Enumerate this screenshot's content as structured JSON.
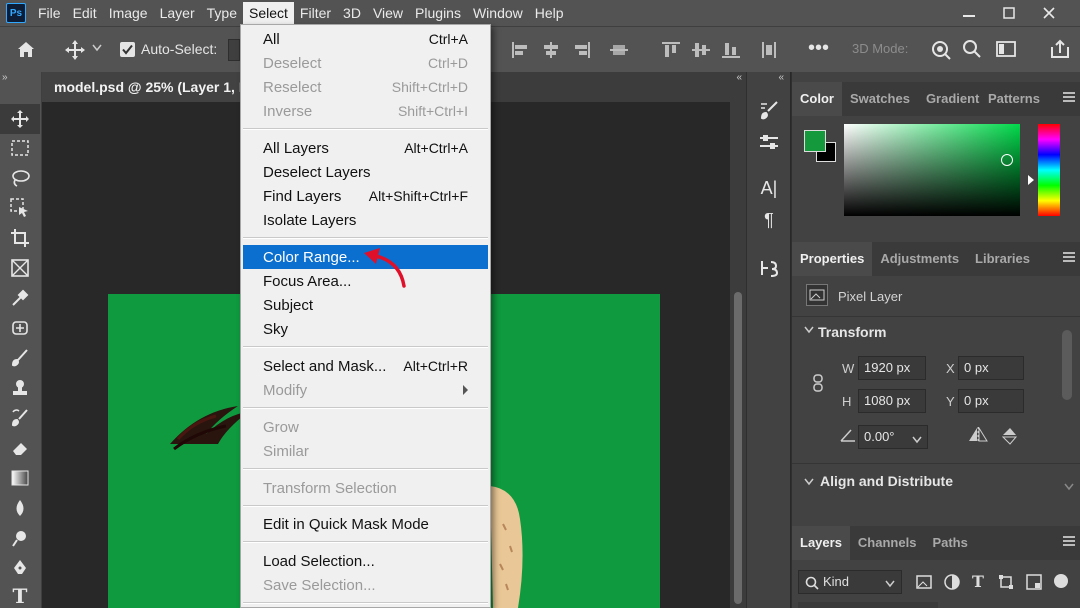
{
  "menubar": {
    "logo": "Ps",
    "items": [
      "File",
      "Edit",
      "Image",
      "Layer",
      "Type",
      "Select",
      "Filter",
      "3D",
      "View",
      "Plugins",
      "Window",
      "Help"
    ],
    "open_menu": "Select",
    "window_controls": [
      "minimize-icon",
      "maximize-icon",
      "close-icon"
    ]
  },
  "options_bar": {
    "auto_select_label": "Auto-Select:",
    "auto_select_checked": true,
    "mode_3d_label": "3D Mode:"
  },
  "document": {
    "tab_title": "model.psd @ 25% (Layer 1, R",
    "canvas_color": "#0f9a3f"
  },
  "select_menu": {
    "items": [
      {
        "label": "All",
        "shortcut": "Ctrl+A",
        "disabled": false
      },
      {
        "label": "Deselect",
        "shortcut": "Ctrl+D",
        "disabled": true
      },
      {
        "label": "Reselect",
        "shortcut": "Shift+Ctrl+D",
        "disabled": true
      },
      {
        "label": "Inverse",
        "shortcut": "Shift+Ctrl+I",
        "disabled": true
      },
      {
        "label": "All Layers",
        "shortcut": "Alt+Ctrl+A",
        "disabled": false
      },
      {
        "label": "Deselect Layers",
        "shortcut": "",
        "disabled": false
      },
      {
        "label": "Find Layers",
        "shortcut": "Alt+Shift+Ctrl+F",
        "disabled": false
      },
      {
        "label": "Isolate Layers",
        "shortcut": "",
        "disabled": false
      },
      {
        "label": "Color Range...",
        "shortcut": "",
        "disabled": false,
        "highlighted": true
      },
      {
        "label": "Focus Area...",
        "shortcut": "",
        "disabled": false
      },
      {
        "label": "Subject",
        "shortcut": "",
        "disabled": false
      },
      {
        "label": "Sky",
        "shortcut": "",
        "disabled": false
      },
      {
        "label": "Select and Mask...",
        "shortcut": "Alt+Ctrl+R",
        "disabled": false
      },
      {
        "label": "Modify",
        "shortcut": "",
        "disabled": true,
        "submenu": true
      },
      {
        "label": "Grow",
        "shortcut": "",
        "disabled": true
      },
      {
        "label": "Similar",
        "shortcut": "",
        "disabled": true
      },
      {
        "label": "Transform Selection",
        "shortcut": "",
        "disabled": true
      },
      {
        "label": "Edit in Quick Mask Mode",
        "shortcut": "",
        "disabled": false
      },
      {
        "label": "Load Selection...",
        "shortcut": "",
        "disabled": false
      },
      {
        "label": "Save Selection...",
        "shortcut": "",
        "disabled": true
      }
    ],
    "highlight_color": "#0b6fd0",
    "annotation_arrow_color": "#e0102a"
  },
  "color_panel": {
    "tabs": [
      "Color",
      "Swatches",
      "Gradients",
      "Patterns"
    ],
    "active_tab": "Color",
    "foreground_color": "#149a3c",
    "background_color": "#000000",
    "picker_hue": "#00d94a"
  },
  "properties_panel": {
    "tabs": [
      "Properties",
      "Adjustments",
      "Libraries"
    ],
    "active_tab": "Properties",
    "layer_type": "Pixel Layer",
    "transform_title": "Transform",
    "w_label": "W",
    "w_value": "1920 px",
    "h_label": "H",
    "h_value": "1080 px",
    "x_label": "X",
    "x_value": "0 px",
    "y_label": "Y",
    "y_value": "0 px",
    "angle_value": "0.00°",
    "align_title": "Align and Distribute"
  },
  "layers_panel": {
    "tabs": [
      "Layers",
      "Channels",
      "Paths"
    ],
    "active_tab": "Layers",
    "filter_kind": "Kind"
  }
}
